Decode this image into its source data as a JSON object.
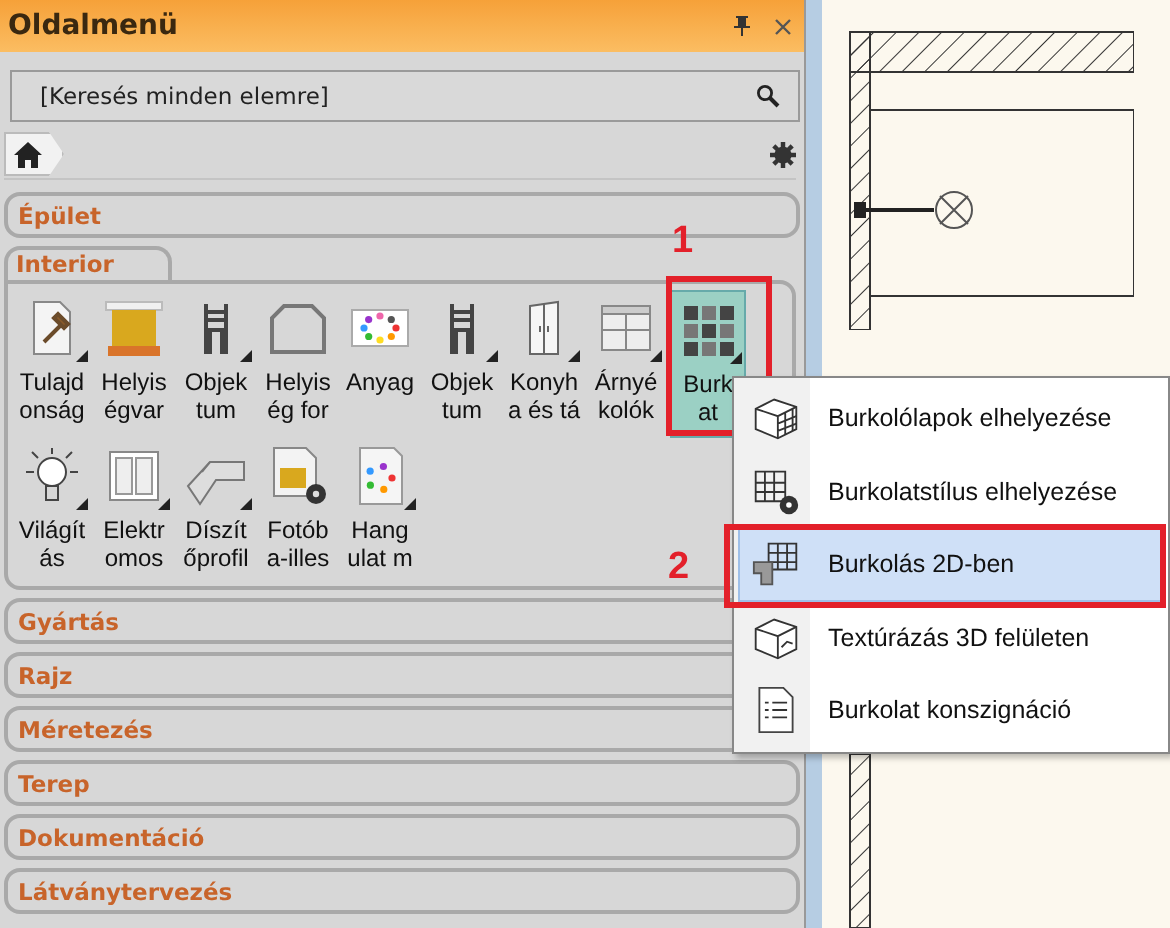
{
  "panel": {
    "title": "Oldalmenü",
    "search": {
      "placeholder": "[Keresés minden elemre]"
    }
  },
  "categories": [
    {
      "label": "Épület",
      "expanded": false
    },
    {
      "label": "Interior",
      "expanded": true,
      "tools": [
        {
          "lines": [
            "Tulajd",
            "onság"
          ],
          "submenu": true,
          "selected": false
        },
        {
          "lines": [
            "Helyis",
            "égvar"
          ],
          "submenu": false,
          "selected": false
        },
        {
          "lines": [
            "Objek",
            "tum"
          ],
          "submenu": true,
          "selected": false
        },
        {
          "lines": [
            "Helyis",
            "ég for"
          ],
          "submenu": false,
          "selected": false
        },
        {
          "lines": [
            "Anyag"
          ],
          "submenu": false,
          "selected": false
        },
        {
          "lines": [
            "Objek",
            "tum"
          ],
          "submenu": true,
          "selected": false
        },
        {
          "lines": [
            "Konyh",
            "a és tá"
          ],
          "submenu": true,
          "selected": false
        },
        {
          "lines": [
            "Árnyé",
            "kolók"
          ],
          "submenu": true,
          "selected": false
        },
        {
          "lines": [
            "Burk",
            "at"
          ],
          "submenu": true,
          "selected": true
        },
        {
          "lines": [
            "Világít",
            "ás"
          ],
          "submenu": true,
          "selected": false
        },
        {
          "lines": [
            "Elektr",
            "omos"
          ],
          "submenu": true,
          "selected": false
        },
        {
          "lines": [
            "Díszít",
            "őprofil"
          ],
          "submenu": true,
          "selected": false
        },
        {
          "lines": [
            "Fotób",
            "a-illes"
          ],
          "submenu": false,
          "selected": false
        },
        {
          "lines": [
            "Hang",
            "ulat m"
          ],
          "submenu": true,
          "selected": false
        }
      ]
    },
    {
      "label": "Gyártás",
      "expanded": false
    },
    {
      "label": "Rajz",
      "expanded": false
    },
    {
      "label": "Méretezés",
      "expanded": false
    },
    {
      "label": "Terep",
      "expanded": false
    },
    {
      "label": "Dokumentáció",
      "expanded": false
    },
    {
      "label": "Látványtervezés",
      "expanded": false
    }
  ],
  "popup_menu": [
    {
      "label": "Burkolólapok elhelyezése",
      "selected": false
    },
    {
      "label": "Burkolatstílus elhelyezése",
      "selected": false
    },
    {
      "label": "Burkolás 2D-ben",
      "selected": true
    },
    {
      "label": "Textúrázás 3D felületen",
      "selected": false
    },
    {
      "label": "Burkolat konszignáció",
      "selected": false
    }
  ],
  "annotations": [
    {
      "label": "1"
    },
    {
      "label": "2"
    }
  ]
}
